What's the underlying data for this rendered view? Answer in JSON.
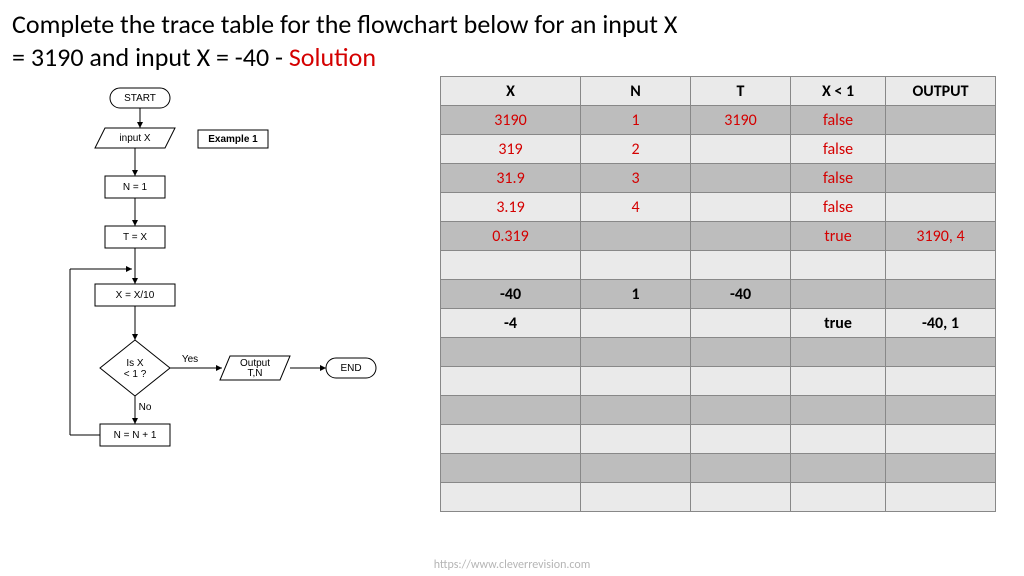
{
  "title": {
    "main": "Complete the trace table for the flowchart below for an input X = 3190 and input X = -40 - ",
    "solution": "Solution"
  },
  "flowchart": {
    "start": "START",
    "input": "input X",
    "example": "Example 1",
    "n1": "N = 1",
    "tx": "T = X",
    "xdiv": "X = X/10",
    "decision": "Is X\n< 1 ?",
    "yes": "Yes",
    "no": "No",
    "output": "Output\nT,N",
    "end": "END",
    "nplus": "N = N + 1"
  },
  "table": {
    "headers": {
      "x": "X",
      "n": "N",
      "t": "T",
      "xlt1": "X < 1",
      "output": "OUTPUT"
    }
  },
  "chart_data": {
    "type": "table",
    "title": "Trace table for X=3190 and X=-40",
    "columns": [
      "X",
      "N",
      "T",
      "X < 1",
      "OUTPUT"
    ],
    "rows": [
      {
        "shaded": true,
        "x": "3190",
        "n": "1",
        "t": "3190",
        "xlt1": "false",
        "output": "",
        "style": "red"
      },
      {
        "shaded": false,
        "x": "319",
        "n": "2",
        "t": "",
        "xlt1": "false",
        "output": "",
        "style": "red"
      },
      {
        "shaded": true,
        "x": "31.9",
        "n": "3",
        "t": "",
        "xlt1": "false",
        "output": "",
        "style": "red"
      },
      {
        "shaded": false,
        "x": "3.19",
        "n": "4",
        "t": "",
        "xlt1": "false",
        "output": "",
        "style": "red"
      },
      {
        "shaded": true,
        "x": "0.319",
        "n": "",
        "t": "",
        "xlt1": "true",
        "output": "3190, 4",
        "style": "red"
      },
      {
        "shaded": false,
        "x": "",
        "n": "",
        "t": "",
        "xlt1": "",
        "output": "",
        "style": ""
      },
      {
        "shaded": true,
        "x": "-40",
        "n": "1",
        "t": "-40",
        "xlt1": "",
        "output": "",
        "style": "bold"
      },
      {
        "shaded": false,
        "x": "-4",
        "n": "",
        "t": "",
        "xlt1": "true",
        "output": "-40, 1",
        "style": "bold"
      },
      {
        "shaded": true,
        "x": "",
        "n": "",
        "t": "",
        "xlt1": "",
        "output": "",
        "style": ""
      },
      {
        "shaded": false,
        "x": "",
        "n": "",
        "t": "",
        "xlt1": "",
        "output": "",
        "style": ""
      },
      {
        "shaded": true,
        "x": "",
        "n": "",
        "t": "",
        "xlt1": "",
        "output": "",
        "style": ""
      },
      {
        "shaded": false,
        "x": "",
        "n": "",
        "t": "",
        "xlt1": "",
        "output": "",
        "style": ""
      },
      {
        "shaded": true,
        "x": "",
        "n": "",
        "t": "",
        "xlt1": "",
        "output": "",
        "style": ""
      },
      {
        "shaded": false,
        "x": "",
        "n": "",
        "t": "",
        "xlt1": "",
        "output": "",
        "style": ""
      }
    ]
  },
  "footer": "https://www.cleverrevision.com"
}
